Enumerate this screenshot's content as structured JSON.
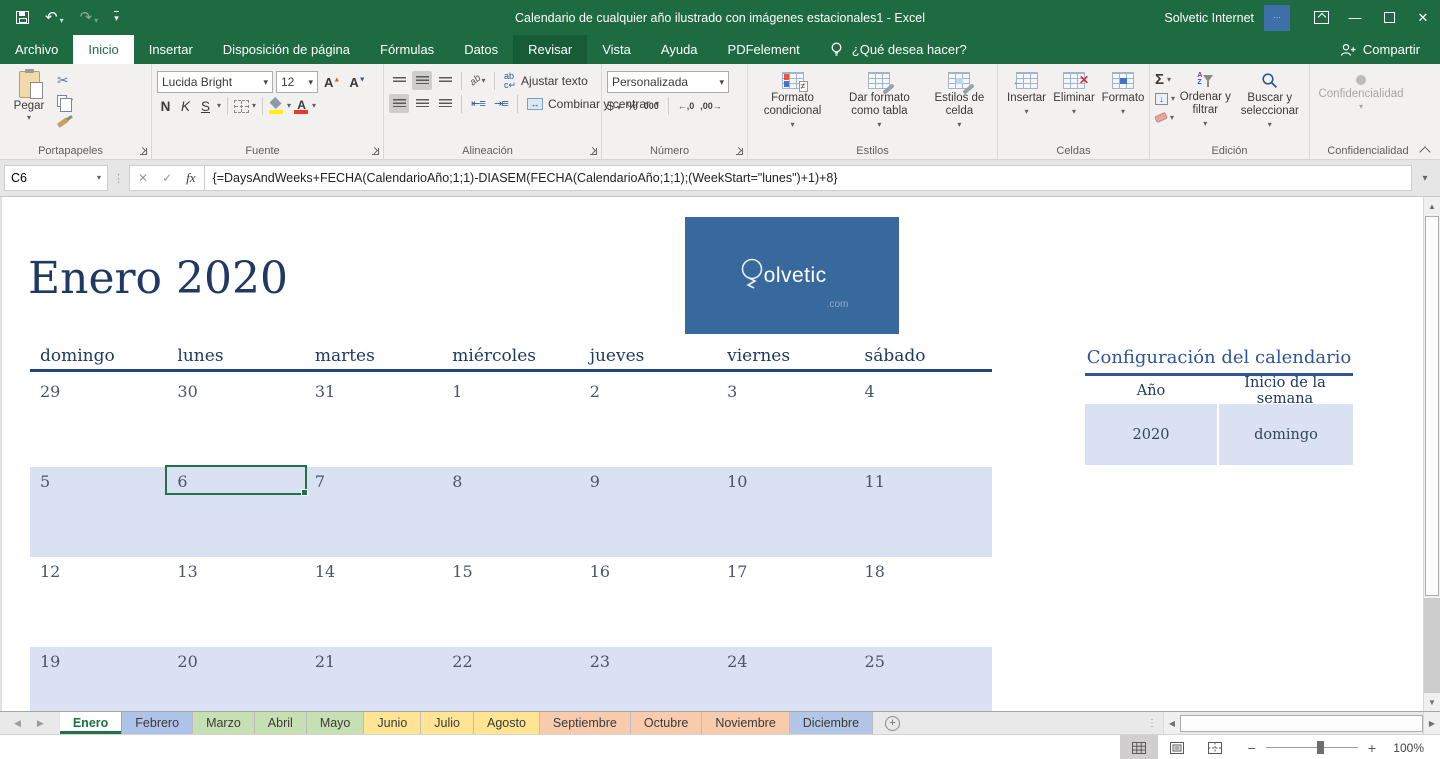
{
  "titlebar": {
    "title": "Calendario de cualquier año ilustrado con imágenes estacionales1 - Excel",
    "user": "Solvetic Internet"
  },
  "menubar": {
    "tabs": [
      {
        "label": "Archivo",
        "state": ""
      },
      {
        "label": "Inicio",
        "state": "active"
      },
      {
        "label": "Insertar",
        "state": ""
      },
      {
        "label": "Disposición de página",
        "state": ""
      },
      {
        "label": "Fórmulas",
        "state": ""
      },
      {
        "label": "Datos",
        "state": ""
      },
      {
        "label": "Revisar",
        "state": "highlight"
      },
      {
        "label": "Vista",
        "state": ""
      },
      {
        "label": "Ayuda",
        "state": ""
      },
      {
        "label": "PDFelement",
        "state": ""
      }
    ],
    "search": "¿Qué desea hacer?",
    "share": "Compartir"
  },
  "ribbon": {
    "groups": [
      "Portapapeles",
      "Fuente",
      "Alineación",
      "Número",
      "Estilos",
      "Celdas",
      "Edición",
      "Confidencialidad"
    ],
    "paste_label": "Pegar",
    "font_name": "Lucida Bright",
    "font_size": "12",
    "font_increase": "A",
    "font_decrease": "A",
    "bold": "N",
    "italic": "K",
    "underline": "S",
    "font_color_letter": "A",
    "wrap_label": "Ajustar texto",
    "merge_label": "Combinar y centrar",
    "number_format": "Personalizada",
    "currency": "$",
    "percent": "%",
    "thousands": "000",
    "cond_label": "Formato condicional",
    "table_label": "Dar formato como tabla",
    "styles_label": "Estilos de celda",
    "insert_label": "Insertar",
    "delete_label": "Eliminar",
    "format_label": "Formato",
    "sort_label": "Ordenar y filtrar",
    "find_label": "Buscar y seleccionar",
    "confidential_label": "Confidencialidad"
  },
  "formula_bar": {
    "name_box": "C6",
    "formula": "{=DaysAndWeeks+FECHA(CalendarioAño;1;1)-DIASEM(FECHA(CalendarioAño;1;1);(WeekStart=\"lunes\")+1)+8}"
  },
  "sheet": {
    "month_title": "Enero 2020",
    "logo_text": "olvetic",
    "logo_suffix": ".com",
    "day_headers": [
      "domingo",
      "lunes",
      "martes",
      "miércoles",
      "jueves",
      "viernes",
      "sábado"
    ],
    "weeks": [
      {
        "days": [
          "29",
          "30",
          "31",
          "1",
          "2",
          "3",
          "4"
        ],
        "shaded": false
      },
      {
        "days": [
          "5",
          "6",
          "7",
          "8",
          "9",
          "10",
          "11"
        ],
        "shaded": true,
        "selected_index": 1
      },
      {
        "days": [
          "12",
          "13",
          "14",
          "15",
          "16",
          "17",
          "18"
        ],
        "shaded": false
      },
      {
        "days": [
          "19",
          "20",
          "21",
          "22",
          "23",
          "24",
          "25"
        ],
        "shaded": true
      }
    ],
    "selected_cell": "6",
    "config": {
      "title": "Configuración del calendario",
      "year_header": "Año",
      "week_header": "Inicio de la semana",
      "year": "2020",
      "week_start": "domingo"
    }
  },
  "sheet_tabs": [
    {
      "label": "Enero",
      "color": "#FFFFFF",
      "active": true
    },
    {
      "label": "Febrero",
      "color": "#AFC3E9",
      "active": false
    },
    {
      "label": "Marzo",
      "color": "#C6E0B4",
      "active": false
    },
    {
      "label": "Abril",
      "color": "#C6E0B4",
      "active": false
    },
    {
      "label": "Mayo",
      "color": "#C6E0B4",
      "active": false
    },
    {
      "label": "Junio",
      "color": "#FFE593",
      "active": false
    },
    {
      "label": "Julio",
      "color": "#FFE593",
      "active": false
    },
    {
      "label": "Agosto",
      "color": "#FFE593",
      "active": false
    },
    {
      "label": "Septiembre",
      "color": "#F7CBAC",
      "active": false
    },
    {
      "label": "Octubre",
      "color": "#F7CBAC",
      "active": false
    },
    {
      "label": "Noviembre",
      "color": "#F7CBAC",
      "active": false
    },
    {
      "label": "Diciembre",
      "color": "#B4C6E7",
      "active": false
    }
  ],
  "status_bar": {
    "zoom": "100%"
  },
  "colors": {
    "titlebar_green": "#1E6B41",
    "tab_highlight_green": "#185C37",
    "accent_green": "#217346",
    "navy": "#1F3864",
    "config_blue": "#2F5597",
    "lavender": "#D9E1F2",
    "logo_blue": "#38699D"
  }
}
